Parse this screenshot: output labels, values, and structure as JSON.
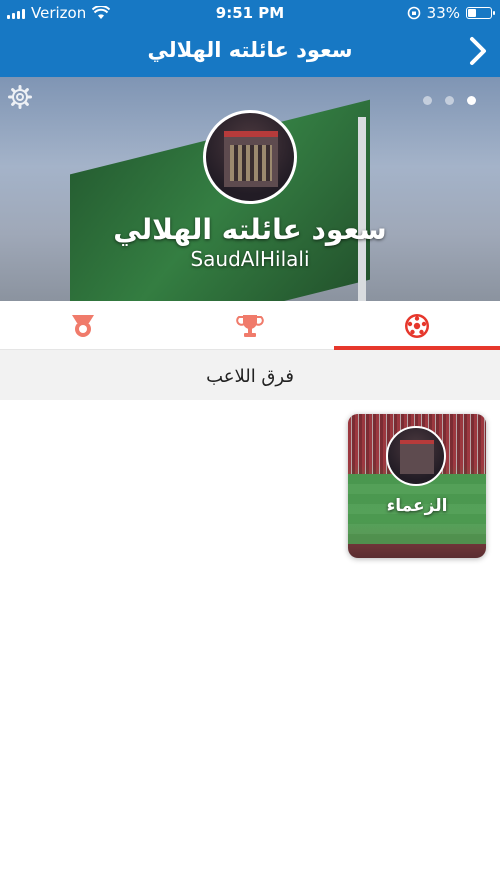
{
  "status_bar": {
    "carrier": "Verizon",
    "time": "9:51 PM",
    "battery_percent": "33%",
    "battery_level": 0.33
  },
  "nav": {
    "title": "سعود عائلته الهلالي",
    "back_icon": "chevron-right-icon"
  },
  "profile": {
    "display_name": "سعود عائلته الهلالي",
    "username": "SaudAlHilali",
    "settings_icon": "gear-icon",
    "page_dots": 3,
    "active_dot": 3
  },
  "tabs": [
    {
      "icon": "medal-icon"
    },
    {
      "icon": "trophy-icon"
    },
    {
      "icon": "football-icon",
      "active": true
    }
  ],
  "colors": {
    "primary": "#1778c4",
    "accent": "#e6372c",
    "tab_icon": "#f07b6b"
  },
  "section": {
    "title": "فرق اللاعب"
  },
  "teams": [
    {
      "name": "الزعماء"
    }
  ]
}
